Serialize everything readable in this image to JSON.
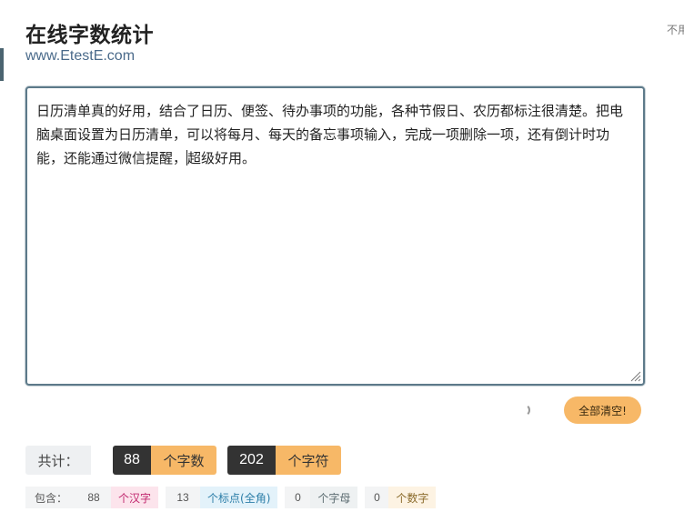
{
  "header": {
    "title": "在线字数统计",
    "url": "www.EtestE.com",
    "corner_text": "不用"
  },
  "editor": {
    "text_before_caret": "日历清单真的好用，结合了日历、便签、待办事项的功能，各种节假日、农历都标注很清楚。把电脑桌面设置为日历清单，可以将每月、每天的备忘事项输入，完成一项删除一项，还有倒计时功能，还能通过微信提醒，",
    "text_after_caret": "超级好用。"
  },
  "actions": {
    "clear_all_label": "全部清空!"
  },
  "totals": {
    "label": "共计：",
    "char_count": "88",
    "char_count_unit": "个字数",
    "symbol_count": "202",
    "symbol_count_unit": "个字符"
  },
  "details": {
    "label": "包含：",
    "items": [
      {
        "value": "88",
        "unit": "个汉字",
        "color": "#c0266d",
        "bg": "#fce4ec"
      },
      {
        "value": "13",
        "unit": "个标点(全角)",
        "color": "#2c7ea8",
        "bg": "#e3f2fa"
      },
      {
        "value": "0",
        "unit": "个字母",
        "color": "#5b6b70",
        "bg": "#eef1f2"
      },
      {
        "value": "0",
        "unit": "个数字",
        "color": "#8a6a2a",
        "bg": "#fdf3e3"
      }
    ]
  },
  "colors": {
    "accent_orange": "#f7b867",
    "dark_badge": "#333333",
    "editor_border": "#5d7a8a"
  }
}
